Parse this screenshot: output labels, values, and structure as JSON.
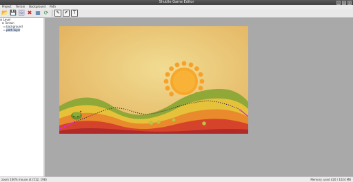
{
  "window": {
    "title": "Shuttle Game Editor"
  },
  "menu": [
    "Project",
    "Terrain",
    "Background",
    "Path"
  ],
  "toolbar": [
    {
      "name": "open-icon",
      "glyph": "📂"
    },
    {
      "name": "save-icon",
      "glyph": "💾"
    },
    {
      "name": "image-icon",
      "glyph": "🖼"
    },
    {
      "name": "delete-icon",
      "glyph": "✖"
    },
    {
      "name": "grid-icon",
      "glyph": "▦"
    },
    {
      "name": "refresh-icon",
      "glyph": "⟳"
    },
    {
      "name": "pen-icon",
      "glyph": "✎"
    },
    {
      "name": "pencil-icon",
      "glyph": "✐"
    },
    {
      "name": "text-icon",
      "glyph": "T"
    }
  ],
  "tree": {
    "root": "Level",
    "child": "Terrain",
    "items": [
      "background",
      "path layer"
    ]
  },
  "status": {
    "left": "zoom 100% mouse at (512, 198)",
    "right": "Memory: used 420 / 1024 MB"
  }
}
